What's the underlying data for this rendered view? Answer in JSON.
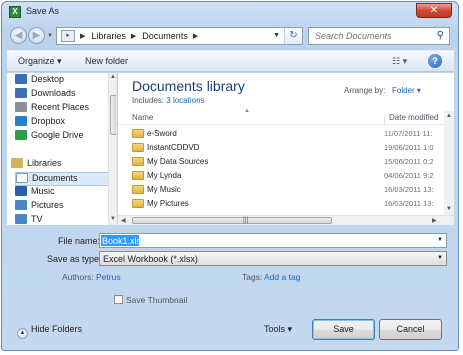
{
  "window": {
    "title": "Save As",
    "close_glyph": "✕"
  },
  "nav": {
    "back_glyph": "◀",
    "forward_glyph": "▶",
    "breadcrumb": [
      "Libraries",
      "Documents"
    ],
    "search_placeholder": "Search Documents"
  },
  "toolbar": {
    "organize_label": "Organize ▾",
    "new_folder_label": "New folder",
    "views_glyph": "☷ ▾",
    "help_glyph": "?"
  },
  "sidebar": {
    "favorites": [
      {
        "label": "Desktop",
        "icon": "desktop-icon",
        "color": "#3b6fb6"
      },
      {
        "label": "Downloads",
        "icon": "downloads-icon",
        "color": "#3b6fb6"
      },
      {
        "label": "Recent Places",
        "icon": "recent-places-icon",
        "color": "#8a8f98"
      },
      {
        "label": "Dropbox",
        "icon": "dropbox-icon",
        "color": "#2b7fd1"
      },
      {
        "label": "Google Drive",
        "icon": "google-drive-icon",
        "color": "#2f9e44"
      }
    ],
    "libraries_label": "Libraries",
    "libraries": [
      {
        "label": "Documents",
        "icon": "documents-icon",
        "color": "#c9d9ec",
        "selected": true
      },
      {
        "label": "Music",
        "icon": "music-icon",
        "color": "#2b5fa8"
      },
      {
        "label": "Pictures",
        "icon": "pictures-icon",
        "color": "#4a86c8"
      },
      {
        "label": "TV",
        "icon": "tv-icon",
        "color": "#4a86c8"
      }
    ]
  },
  "library": {
    "title": "Documents library",
    "includes_prefix": "Includes:",
    "includes_link": "3 locations",
    "arrange_label": "Arrange by:",
    "arrange_value": "Folder ▾"
  },
  "columns": {
    "name": "Name",
    "date": "Date modified"
  },
  "files": [
    {
      "name": "e-Sword",
      "date": "11/07/2011 11:"
    },
    {
      "name": "InstantCDDVD",
      "date": "19/06/2011 1:0"
    },
    {
      "name": "My Data Sources",
      "date": "15/06/2011 0:2"
    },
    {
      "name": "My Lynda",
      "date": "04/06/2011 9:2"
    },
    {
      "name": "My Music",
      "date": "16/03/2011 13:"
    },
    {
      "name": "My Pictures",
      "date": "16/03/2011 13:"
    }
  ],
  "form": {
    "file_name_label": "File name:",
    "file_name_value": "Book1.xlsx",
    "save_as_type_label": "Save as type:",
    "save_as_type_value": "Excel Workbook (*.xlsx)",
    "authors_label": "Authors:",
    "authors_value": "Petrus",
    "tags_label": "Tags:",
    "tags_value": "Add a tag",
    "save_thumbnail_label": "Save Thumbnail"
  },
  "footer": {
    "hide_folders_label": "Hide Folders",
    "tools_label": "Tools ▾",
    "save_label": "Save",
    "cancel_label": "Cancel"
  }
}
